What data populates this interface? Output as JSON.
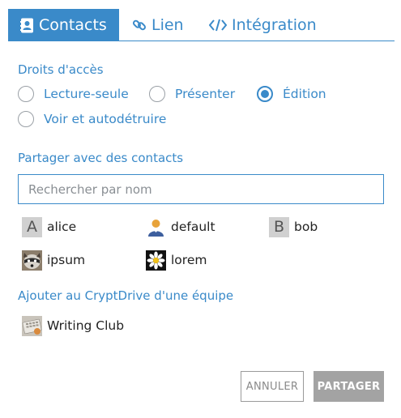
{
  "tabs": [
    {
      "label": "Contacts",
      "icon": "contact-card-icon",
      "active": true
    },
    {
      "label": "Lien",
      "icon": "link-icon",
      "active": false
    },
    {
      "label": "Intégration",
      "icon": "code-icon",
      "active": false
    }
  ],
  "access": {
    "title": "Droits d'accès",
    "options": [
      "Lecture-seule",
      "Présenter",
      "Édition",
      "Voir et autodétruire"
    ],
    "selected": "Édition"
  },
  "share": {
    "title": "Partager avec des contacts",
    "search_placeholder": "Rechercher par nom",
    "contacts": [
      {
        "name": "alice",
        "avatar_letter": "A"
      },
      {
        "name": "default",
        "avatar": "user-silhouette-icon"
      },
      {
        "name": "bob",
        "avatar_letter": "B"
      },
      {
        "name": "ipsum",
        "avatar": "raccoon-avatar-icon"
      },
      {
        "name": "lorem",
        "avatar": "daisy-avatar-icon"
      }
    ]
  },
  "team": {
    "title": "Ajouter au CryptDrive d'une équipe",
    "teams": [
      {
        "name": "Writing Club",
        "avatar": "keyboard-avatar-icon"
      }
    ]
  },
  "buttons": {
    "cancel": "ANNULER",
    "share": "PARTAGER"
  },
  "colors": {
    "accent": "#3a8ac9",
    "share_button_disabled": "#a3a3a3"
  }
}
